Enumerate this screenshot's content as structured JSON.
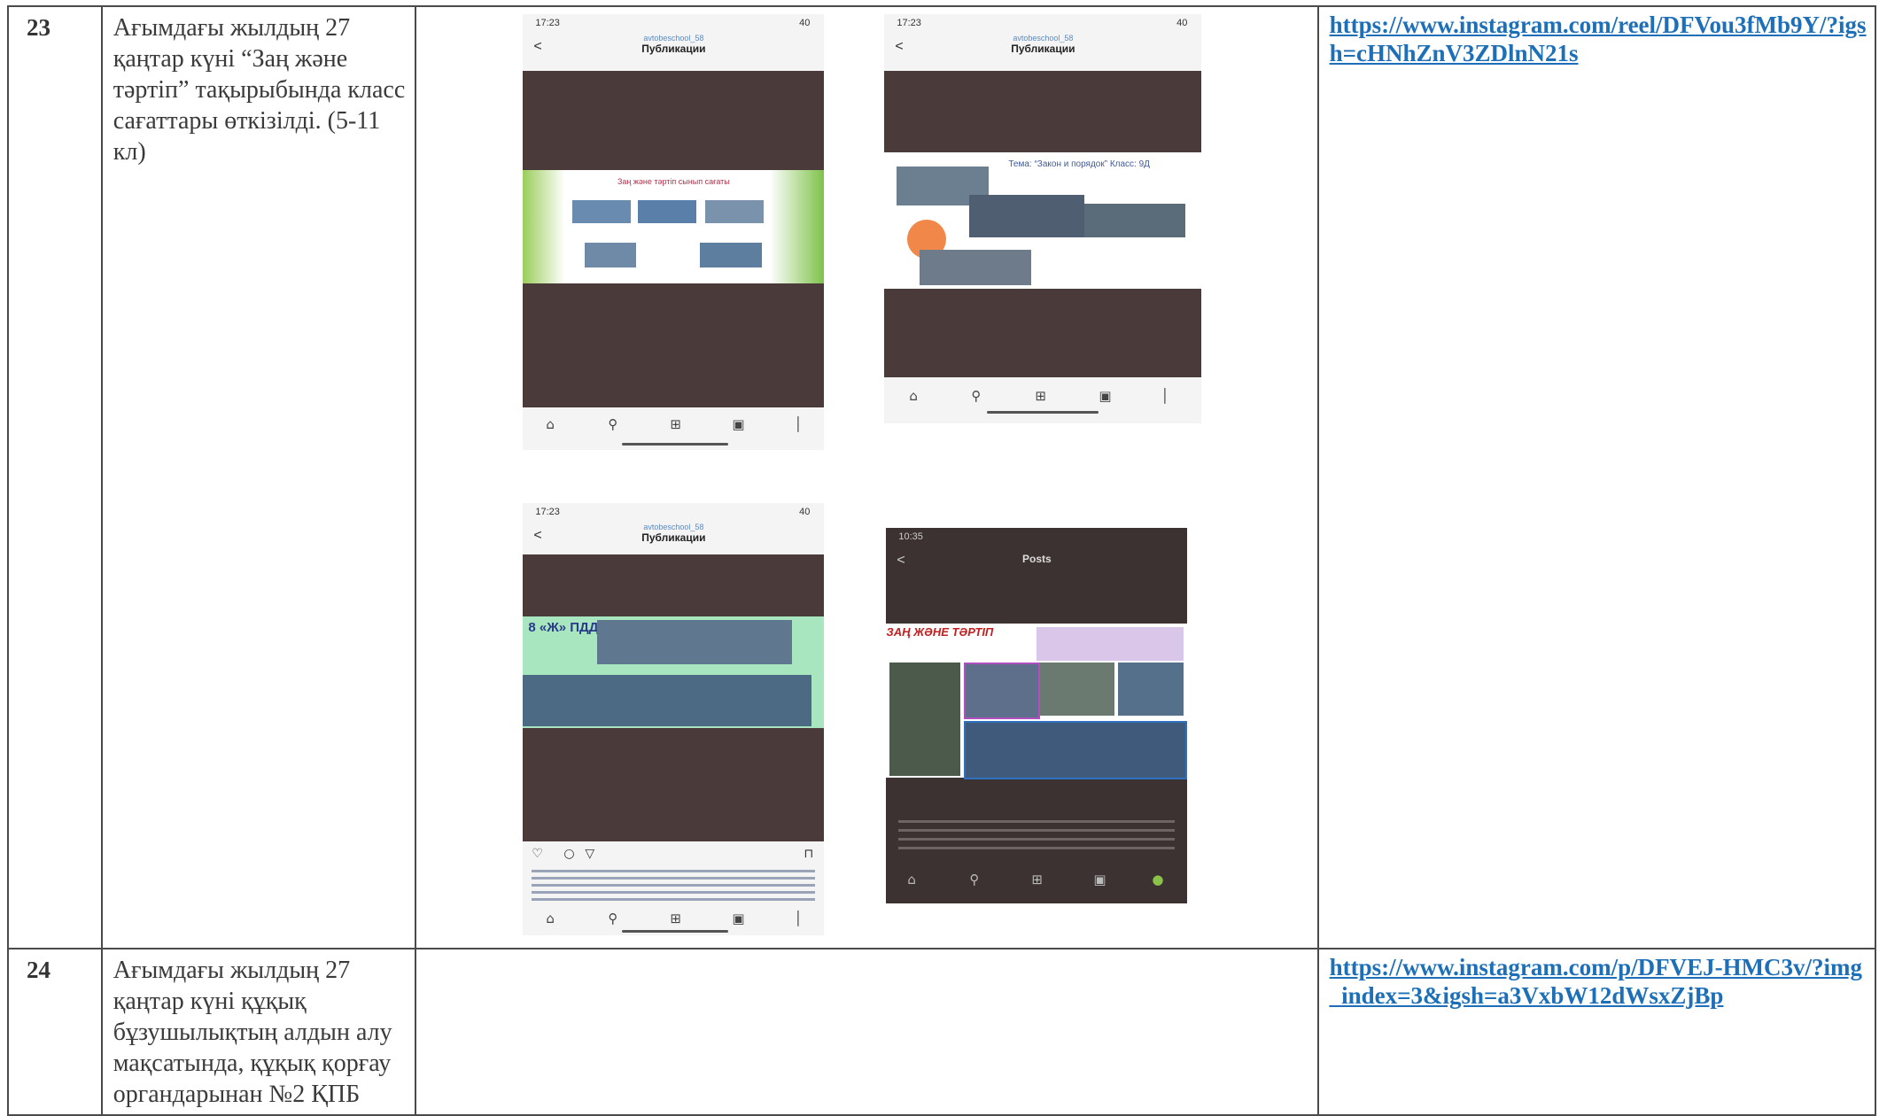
{
  "rows": [
    {
      "number": "23",
      "description": "Ағымдағы жылдың 27 қаңтар күні “Заң және тәртіп” тақырыбында класс сағаттары өткізілді. (5-11 кл)",
      "link": "https://www.instagram.com/reel/DFVou3fMb9Y/?igsh=cHNhZnV3ZDlnN21s",
      "screenshots": [
        {
          "time": "17:23",
          "signal": "40",
          "account": "avtobeschool_58",
          "title": "Публикации",
          "slide_caption": "Заң және тәртіп сынып сағаты"
        },
        {
          "time": "17:23",
          "signal": "40",
          "account": "avtobeschool_58",
          "title": "Публикации",
          "slide_caption": "Тема: “Закон и порядок” Класс: 9Д"
        },
        {
          "time": "17:23",
          "signal": "40",
          "account": "avtobeschool_58",
          "title": "Публикации",
          "slide_caption": "8 «Ж» ПДД"
        },
        {
          "time": "10:35",
          "signal": "",
          "account": "",
          "title": "Posts",
          "slide_caption": "ЗАҢ ЖӘНЕ ТӘРТІП"
        }
      ]
    },
    {
      "number": "24",
      "description": "Ағымдағы жылдың 27 қаңтар күні құқық бұзушылықтың алдын алу мақсатында, құқық қорғау органдарынан №2 ҚПБ",
      "link": "https://www.instagram.com/p/DFVEJ-HMC3v/?img_index=3&igsh=a3VxbW12dWsxZjBp"
    }
  ]
}
